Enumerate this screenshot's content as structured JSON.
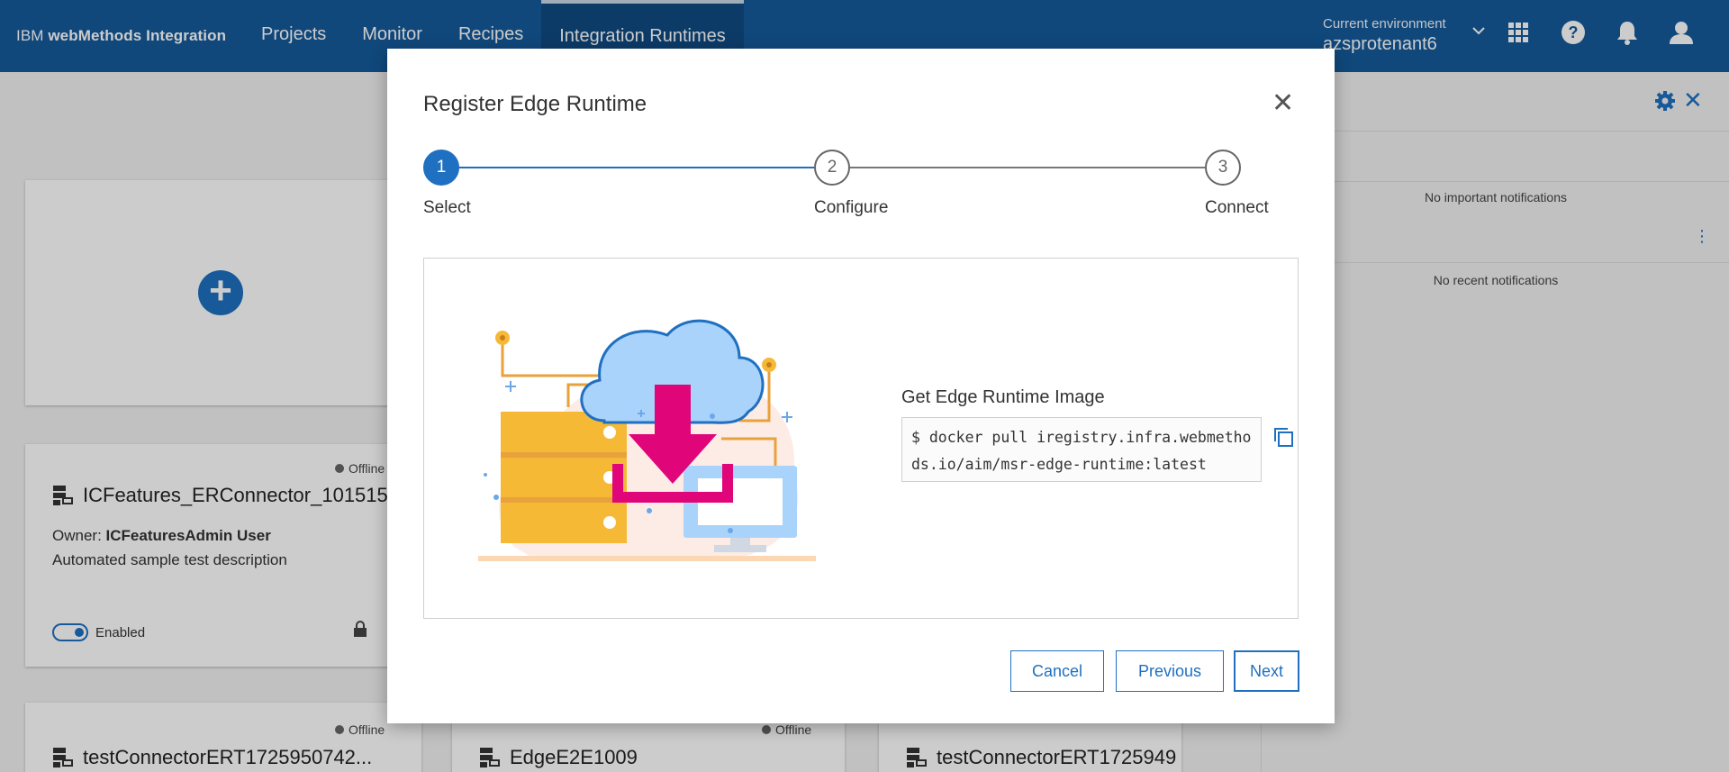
{
  "header": {
    "brand_prefix": "IBM ",
    "brand_name": "webMethods Integration",
    "nav": [
      "Projects",
      "Monitor",
      "Recipes",
      "Integration Runtimes"
    ],
    "active_nav": "Integration Runtimes",
    "env_label": "Current environment",
    "env_name": "azsprotenant6",
    "icons": [
      "chevron-down-icon",
      "apps-grid-icon",
      "help-icon",
      "notification-bell-icon",
      "user-icon"
    ]
  },
  "runtimes": {
    "card1": {
      "status": "Offline",
      "title": "ICFeatures_ERConnector_101515",
      "owner_label": "Owner: ",
      "owner": "ICFeaturesAdmin User",
      "description": "Automated sample test description",
      "toggle_label": "Enabled"
    },
    "row2": [
      {
        "status": "Offline",
        "title": "testConnectorERT1725950742..."
      },
      {
        "status": "Offline",
        "title": "EdgeE2E1009"
      },
      {
        "status": "",
        "title": "testConnectorERT1725949"
      }
    ]
  },
  "notifications": {
    "important_empty": "No important notifications",
    "recent_empty": "No recent notifications"
  },
  "modal": {
    "title": "Register Edge Runtime",
    "steps": [
      {
        "number": "1",
        "label": "Select"
      },
      {
        "number": "2",
        "label": "Configure"
      },
      {
        "number": "3",
        "label": "Connect"
      }
    ],
    "active_step": 1,
    "image_heading": "Get Edge Runtime Image",
    "prompt": "$",
    "command_line1": "docker pull iregistry.infra.webmetho",
    "command_line2": "ds.io/aim/msr-edge-runtime:latest",
    "buttons": {
      "cancel": "Cancel",
      "previous": "Previous",
      "next": "Next"
    }
  },
  "colors": {
    "topbar": "#155a9b",
    "accent": "#1f70c1",
    "download_arrow": "#e0067a",
    "server": "#f6b936",
    "cloud": "#a9d3fb"
  }
}
